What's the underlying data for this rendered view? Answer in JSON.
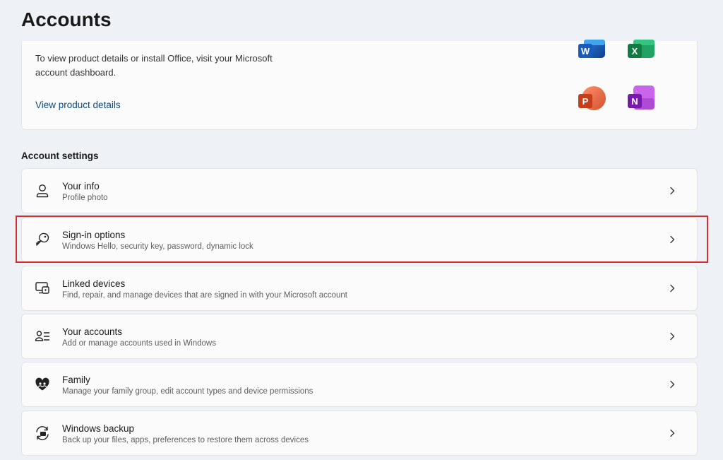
{
  "page": {
    "title": "Accounts"
  },
  "office": {
    "description": "To view product details or install Office, visit your Microsoft account dashboard.",
    "link_label": "View product details",
    "apps": [
      {
        "name": "word-icon",
        "letter": "W"
      },
      {
        "name": "excel-icon",
        "letter": "X"
      },
      {
        "name": "powerpoint-icon",
        "letter": "P"
      },
      {
        "name": "onenote-icon",
        "letter": "N"
      }
    ]
  },
  "account_settings": {
    "section_title": "Account settings",
    "items": [
      {
        "title": "Your info",
        "subtitle": "Profile photo",
        "icon": "person-icon"
      },
      {
        "title": "Sign-in options",
        "subtitle": "Windows Hello, security key, password, dynamic lock",
        "icon": "key-icon"
      },
      {
        "title": "Linked devices",
        "subtitle": "Find, repair, and manage devices that are signed in with your Microsoft account",
        "icon": "devices-icon"
      },
      {
        "title": "Your accounts",
        "subtitle": "Add or manage accounts used in Windows",
        "icon": "accounts-list-icon"
      },
      {
        "title": "Family",
        "subtitle": "Manage your family group, edit account types and device permissions",
        "icon": "family-heart-icon"
      },
      {
        "title": "Windows backup",
        "subtitle": "Back up your files, apps, preferences to restore them across devices",
        "icon": "backup-icon"
      }
    ]
  },
  "colors": {
    "highlight": "#d32f2f",
    "link": "#0f4a7c",
    "word": "#185abd",
    "excel": "#107c41",
    "powerpoint": "#c43e1c",
    "onenote": "#7719aa"
  }
}
